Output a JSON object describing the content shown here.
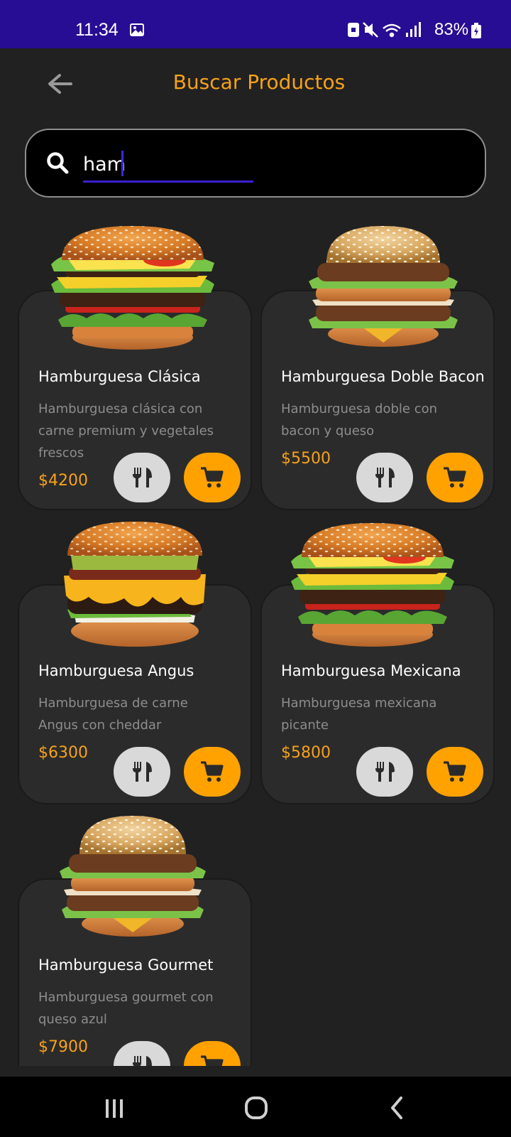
{
  "status_bar": {
    "time": "11:34",
    "battery": "83%",
    "icons": [
      "gallery-icon",
      "vpn-icon",
      "mute-icon",
      "wifi-icon",
      "signal-icon",
      "battery-icon"
    ]
  },
  "header": {
    "title": "Buscar Productos",
    "back_icon": "arrow-left-icon"
  },
  "search": {
    "value": "ham",
    "icon": "search-icon"
  },
  "products": [
    {
      "name": "Hamburguesa Clásica",
      "description": "Hamburguesa clásica con carne premium y vegetales frescos",
      "price": "$4200"
    },
    {
      "name": "Hamburguesa Doble Bacon",
      "description": "Hamburguesa doble con bacon y queso",
      "price": "$5500"
    },
    {
      "name": "Hamburguesa Angus",
      "description": "Hamburguesa de carne Angus con cheddar",
      "price": "$6300"
    },
    {
      "name": "Hamburguesa Mexicana",
      "description": "Hamburguesa mexicana picante",
      "price": "$5800"
    },
    {
      "name": "Hamburguesa Gourmet",
      "description": "Hamburguesa gourmet con queso azul",
      "price": "$7900"
    }
  ],
  "product_actions": {
    "detail_icon": "fork-knife-icon",
    "cart_icon": "shopping-cart-icon"
  },
  "nav_bar": {
    "icons": [
      "recent-apps-icon",
      "home-icon",
      "back-chevron-icon"
    ]
  },
  "colors": {
    "status_bar": "#270d93",
    "background": "#212121",
    "card": "#2b2b2b",
    "accent": "#f7a21a",
    "cart_button": "#ffa200",
    "detail_button": "#d9d9d9",
    "description": "#8d8d8d"
  }
}
